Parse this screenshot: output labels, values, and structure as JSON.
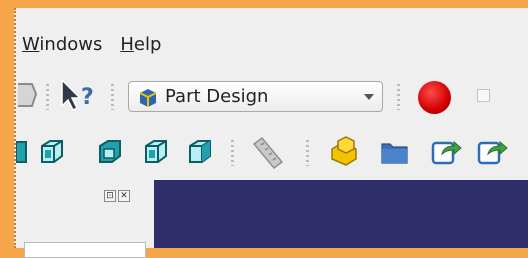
{
  "menubar": {
    "windows": {
      "mnemonic": "W",
      "rest": "indows"
    },
    "help": {
      "mnemonic": "H",
      "rest": "elp"
    }
  },
  "toolbar": {
    "workbench_selector": "Part Design",
    "icons_row1": [
      "cut-icon",
      "whats-this-icon",
      "part-design-workbench-icon",
      "macro-record-icon",
      "checkbox"
    ],
    "icons_row2": [
      "view-box-icon",
      "view-isometric-icon",
      "view-front-icon",
      "view-top-icon",
      "view-right-icon",
      "measure-ruler-icon",
      "part-icon",
      "folder-icon",
      "export-icon",
      "export-alt-icon"
    ]
  },
  "panel": {
    "float_button": "⊡",
    "close_button": "✕"
  },
  "colors": {
    "background": "#f6a64a",
    "window_bg": "#efefef",
    "viewport": "#2f2e6a",
    "record": "#d10000",
    "cube": "#1b8a96"
  }
}
